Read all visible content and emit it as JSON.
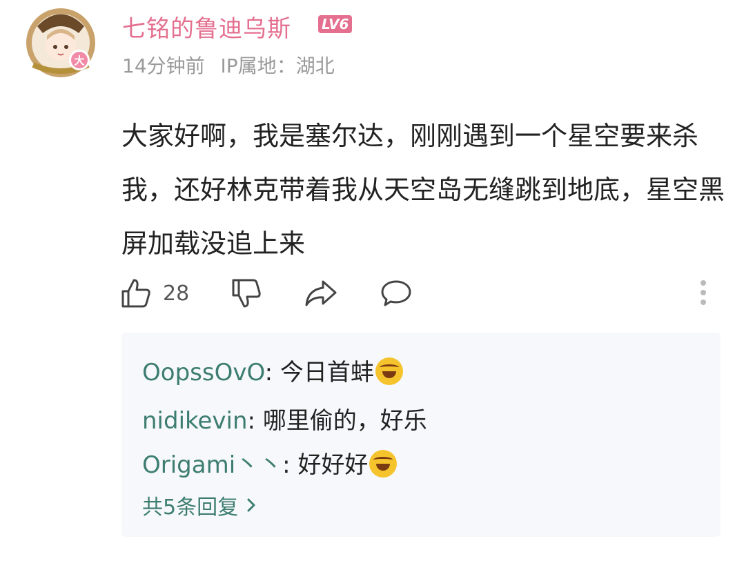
{
  "post": {
    "username": "七铭的鲁迪乌斯",
    "level": "LV6",
    "time": "14分钟前",
    "ip": "IP属地：湖北",
    "avatar_badge": "大",
    "text": "大家好啊，我是塞尔达，刚刚遇到一个星空要来杀我，还好林克带着我从天空岛无缝跳到地底，星空黑屏加载没追上来"
  },
  "actions": {
    "like_count": "28",
    "icons": [
      "thumbs-up-icon",
      "thumbs-down-icon",
      "share-icon",
      "comment-icon",
      "more-vertical-icon"
    ]
  },
  "replies": {
    "items": [
      {
        "nick": "OopssOvO",
        "sep": ": ",
        "text": "今日首蚌",
        "emoji": "rolling-laugh-emoji"
      },
      {
        "nick": "nidikevin",
        "sep": ": ",
        "text": "哪里偷的，好乐",
        "emoji": ""
      },
      {
        "nick": "Origami丶丶",
        "sep": ": ",
        "text": "好好好",
        "emoji": "rolling-laugh-emoji"
      }
    ],
    "more_label": "共5条回复"
  },
  "colors": {
    "username": "#e46f8f",
    "nick": "#3d7d71",
    "reply_bg": "#f6f8fb",
    "meta": "#9a9a9a"
  }
}
